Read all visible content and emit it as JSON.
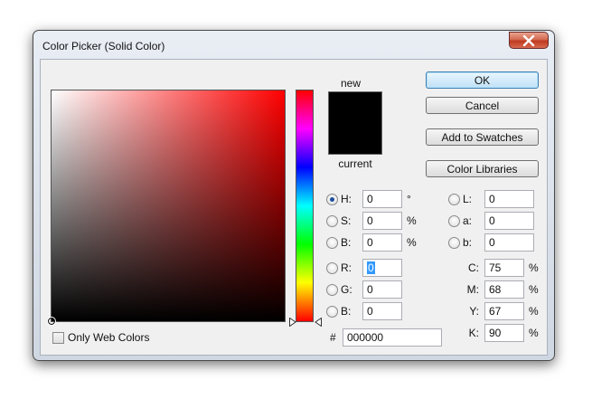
{
  "window": {
    "title": "Color Picker (Solid Color)"
  },
  "buttons": {
    "ok": "OK",
    "cancel": "Cancel",
    "add_to_swatches": "Add to Swatches",
    "color_libraries": "Color Libraries"
  },
  "swatch": {
    "new_label": "new",
    "current_label": "current",
    "new_color": "#000000"
  },
  "hsb": [
    {
      "label": "H:",
      "value": "0",
      "unit": "°",
      "selected": true
    },
    {
      "label": "S:",
      "value": "0",
      "unit": "%",
      "selected": false
    },
    {
      "label": "B:",
      "value": "0",
      "unit": "%",
      "selected": false
    }
  ],
  "rgb": [
    {
      "label": "R:",
      "value": "0",
      "selected": false
    },
    {
      "label": "G:",
      "value": "0",
      "selected": false
    },
    {
      "label": "B:",
      "value": "0",
      "selected": false
    }
  ],
  "lab": [
    {
      "label": "L:",
      "value": "0"
    },
    {
      "label": "a:",
      "value": "0"
    },
    {
      "label": "b:",
      "value": "0"
    }
  ],
  "cmyk": [
    {
      "label": "C:",
      "value": "75",
      "unit": "%"
    },
    {
      "label": "M:",
      "value": "68",
      "unit": "%"
    },
    {
      "label": "Y:",
      "value": "67",
      "unit": "%"
    },
    {
      "label": "K:",
      "value": "90",
      "unit": "%"
    }
  ],
  "hex": {
    "prefix": "#",
    "value": "000000"
  },
  "only_web_colors": {
    "label": "Only Web Colors",
    "checked": false
  },
  "colors": {
    "hue_base": "#ff0000",
    "accent": "#3c7fb1"
  }
}
